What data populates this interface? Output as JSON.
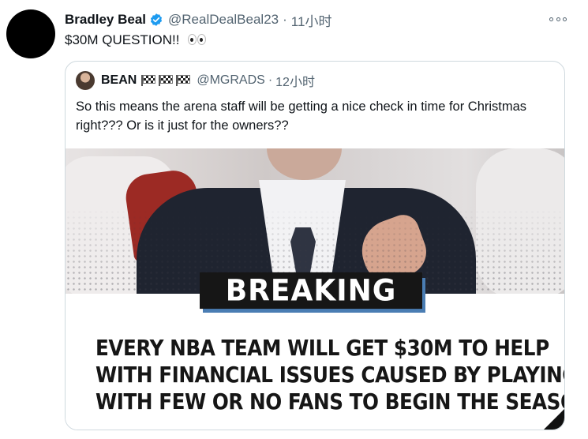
{
  "tweet": {
    "author_name": "Bradley Beal",
    "author_handle": "@RealDealBeal23",
    "separator": "·",
    "timestamp": "11小时",
    "text": "$30M QUESTION!!",
    "text_emoji": "eyes"
  },
  "quoted": {
    "author_name": "BEAN",
    "author_flags": [
      "checkered-flag",
      "checkered-flag",
      "checkered-flag"
    ],
    "author_handle": "@MGRADS",
    "separator": "·",
    "timestamp": "12小时",
    "text": "So this means the arena staff will be getting a nice check in time for Christmas right??? Or is it just for the owners??",
    "media": {
      "badge": "BREAKING",
      "headline_lines": [
        "EVERY NBA TEAM WILL GET $30M TO HELP",
        "WITH FINANCIAL ISSUES CAUSED BY PLAYING",
        "WITH FEW OR NO FANS TO BEGIN THE SEASON"
      ]
    }
  },
  "colors": {
    "verified": "#1d9bf0",
    "muted_text": "#536471",
    "badge_shadow": "#4a7db3"
  }
}
